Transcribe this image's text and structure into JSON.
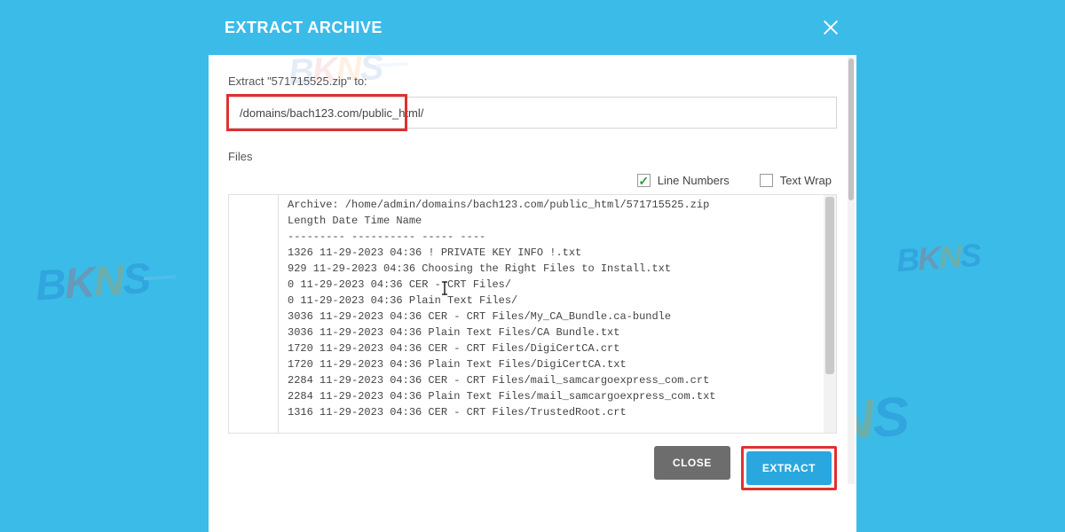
{
  "dialog": {
    "title": "EXTRACT ARCHIVE",
    "prompt": "Extract \"571715525.zip\" to:",
    "path_value": "/domains/bach123.com/public_html/",
    "files_label": "Files",
    "options": {
      "line_numbers": {
        "label": "Line Numbers",
        "checked": true
      },
      "text_wrap": {
        "label": "Text Wrap",
        "checked": false
      }
    },
    "buttons": {
      "close": "CLOSE",
      "extract": "EXTRACT"
    },
    "file_lines": [
      "Archive: /home/admin/domains/bach123.com/public_html/571715525.zip",
      "Length Date Time Name",
      "--------- ---------- ----- ----",
      "1326 11-29-2023 04:36 ! PRIVATE KEY INFO !.txt",
      "929 11-29-2023 04:36 Choosing the Right Files to Install.txt",
      "0 11-29-2023 04:36 CER - CRT Files/",
      "0 11-29-2023 04:36 Plain Text Files/",
      "3036 11-29-2023 04:36 CER - CRT Files/My_CA_Bundle.ca-bundle",
      "3036 11-29-2023 04:36 Plain Text Files/CA Bundle.txt",
      "1720 11-29-2023 04:36 CER - CRT Files/DigiCertCA.crt",
      "1720 11-29-2023 04:36 Plain Text Files/DigiCertCA.txt",
      "2284 11-29-2023 04:36 CER - CRT Files/mail_samcargoexpress_com.crt",
      "2284 11-29-2023 04:36 Plain Text Files/mail_samcargoexpress_com.txt",
      "1316 11-29-2023 04:36 CER - CRT Files/TrustedRoot.crt"
    ]
  },
  "watermark": {
    "b": "B",
    "k": "K",
    "n": "N",
    "s": "S"
  }
}
